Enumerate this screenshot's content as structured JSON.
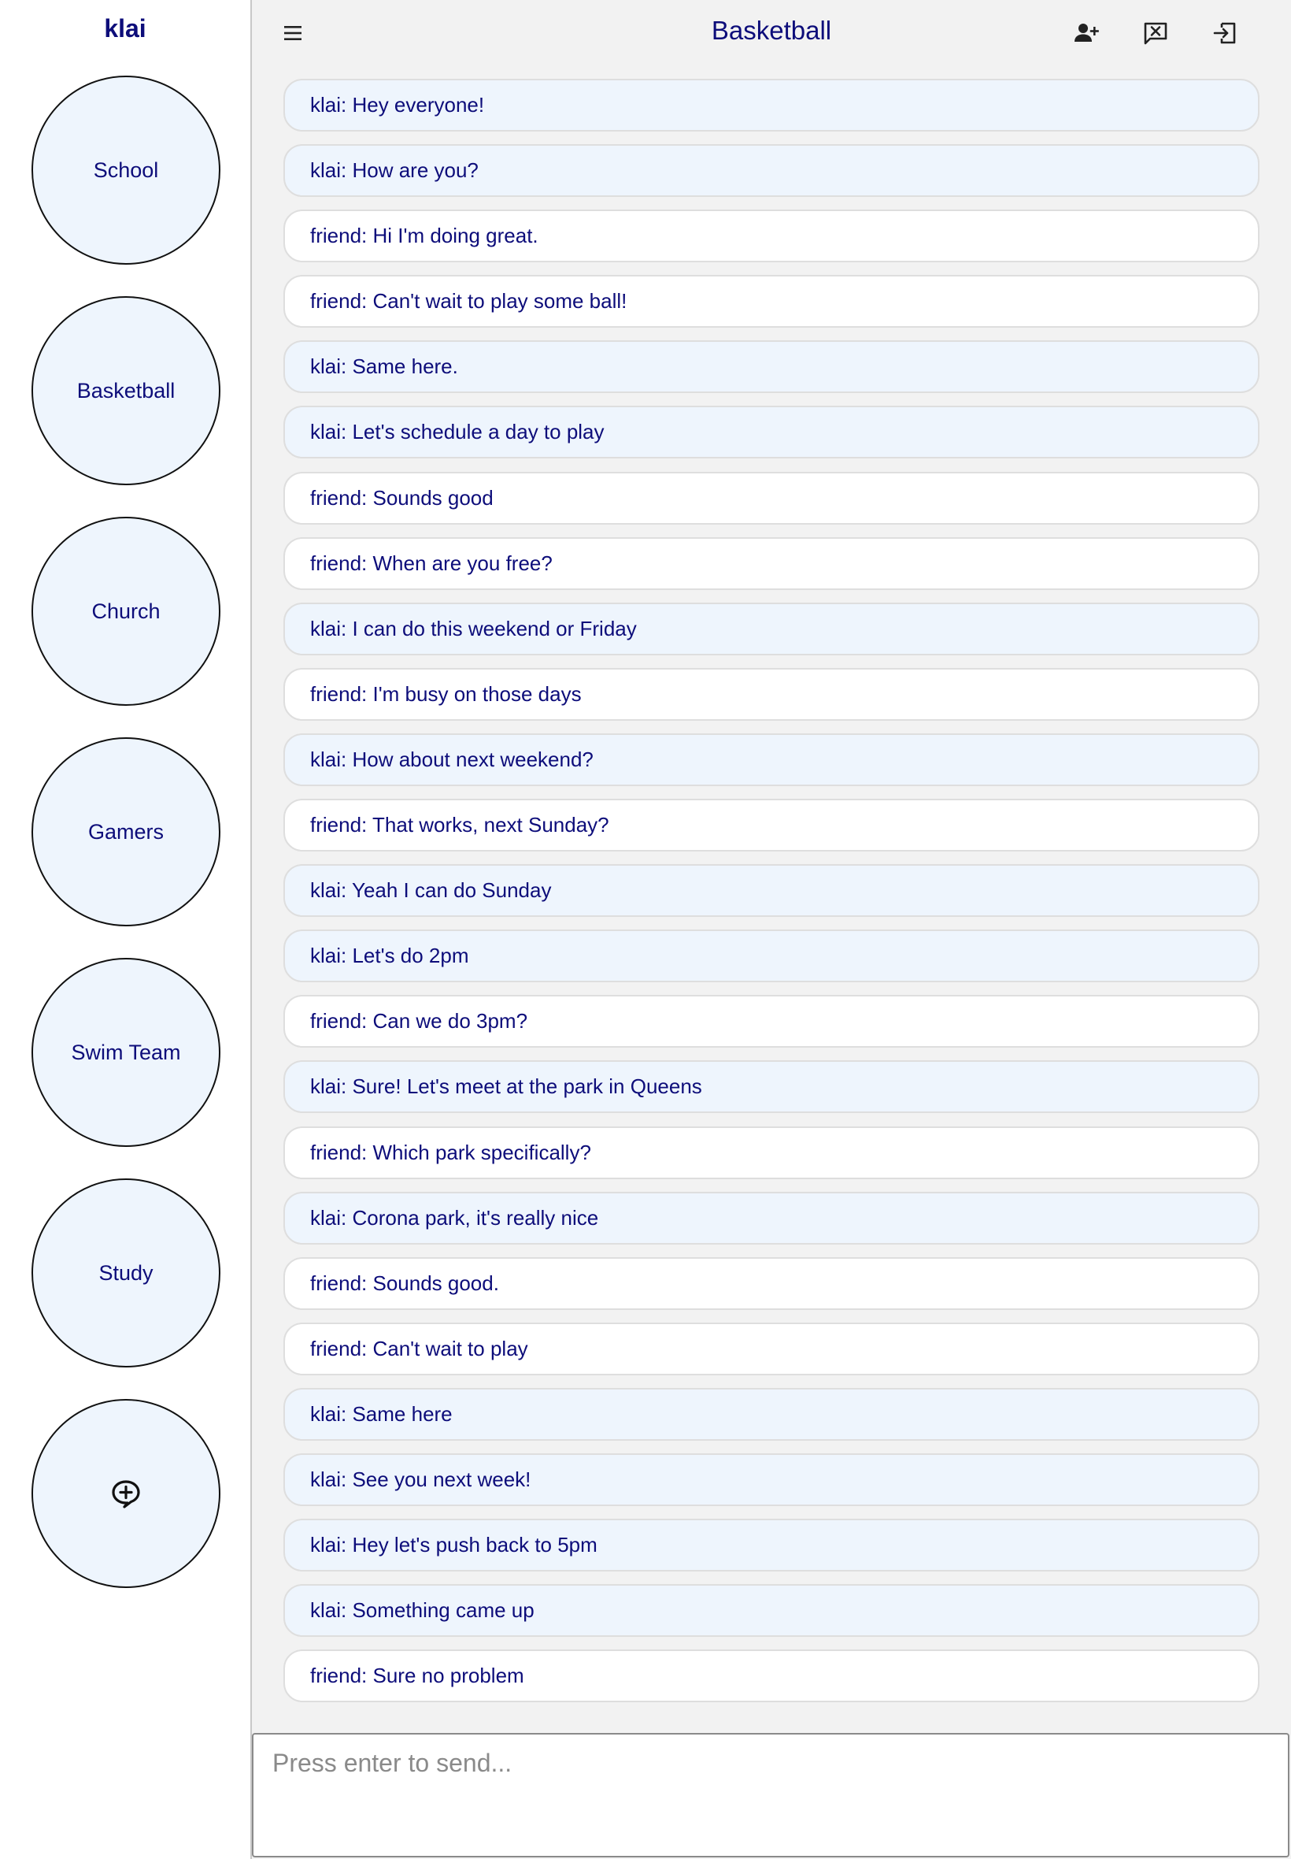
{
  "sidebar": {
    "username": "klai",
    "groups": [
      {
        "label": "School"
      },
      {
        "label": "Basketball"
      },
      {
        "label": "Church"
      },
      {
        "label": "Gamers"
      },
      {
        "label": "Swim Team"
      },
      {
        "label": "Study"
      }
    ],
    "new_group_icon": "chat-plus-icon"
  },
  "header": {
    "title": "Basketball",
    "icons": [
      "menu-icon",
      "add-user-icon",
      "close-chat-icon",
      "leave-icon"
    ]
  },
  "messages": [
    {
      "text": "klai: Hey everyone!",
      "self": true
    },
    {
      "text": "klai: How are you?",
      "self": true
    },
    {
      "text": "friend: Hi I'm doing great.",
      "self": false
    },
    {
      "text": "friend: Can't wait to play some ball!",
      "self": false
    },
    {
      "text": "klai: Same here.",
      "self": true
    },
    {
      "text": "klai: Let's schedule a day to play",
      "self": true
    },
    {
      "text": "friend: Sounds good",
      "self": false
    },
    {
      "text": "friend: When are you free?",
      "self": false
    },
    {
      "text": "klai: I can do this weekend or Friday",
      "self": true
    },
    {
      "text": "friend: I'm busy on those days",
      "self": false
    },
    {
      "text": "klai: How about next weekend?",
      "self": true
    },
    {
      "text": "friend: That works, next Sunday?",
      "self": false
    },
    {
      "text": "klai: Yeah I can do Sunday",
      "self": true
    },
    {
      "text": "klai: Let's do 2pm",
      "self": true
    },
    {
      "text": "friend: Can we do 3pm?",
      "self": false
    },
    {
      "text": "klai: Sure! Let's meet at the park in Queens",
      "self": true
    },
    {
      "text": "friend: Which park specifically?",
      "self": false
    },
    {
      "text": "klai: Corona park, it's really nice",
      "self": true
    },
    {
      "text": "friend: Sounds good.",
      "self": false
    },
    {
      "text": "friend: Can't wait to play",
      "self": false
    },
    {
      "text": "klai: Same here",
      "self": true
    },
    {
      "text": "klai: See you next week!",
      "self": true
    },
    {
      "text": "klai: Hey let's push back to 5pm",
      "self": true
    },
    {
      "text": "klai: Something came up",
      "self": true
    },
    {
      "text": "friend: Sure no problem",
      "self": false
    }
  ],
  "composer": {
    "placeholder": "Press enter to send...",
    "value": ""
  },
  "colors": {
    "text_accent": "#0d0d7a",
    "self_bubble": "#eef5fd",
    "other_bubble": "#ffffff",
    "background": "#f2f2f2"
  }
}
